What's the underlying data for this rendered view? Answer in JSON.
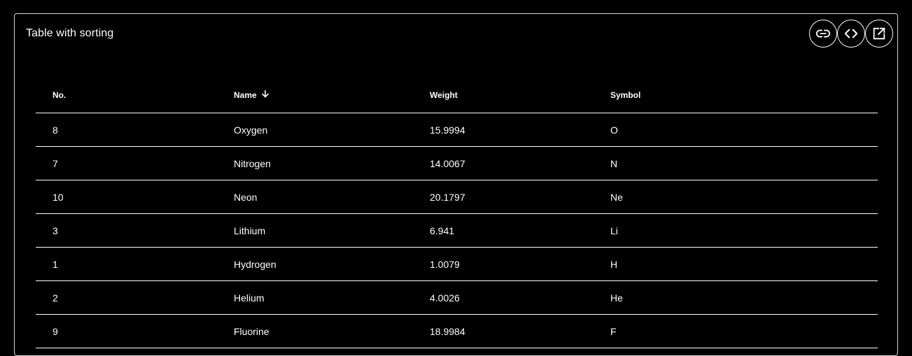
{
  "card": {
    "title": "Table with sorting",
    "actions": [
      {
        "icon": "link-icon",
        "name": "copy-link-button"
      },
      {
        "icon": "code-icon",
        "name": "view-code-button"
      },
      {
        "icon": "open-in-new-icon",
        "name": "open-in-new-button"
      }
    ]
  },
  "table": {
    "columns": {
      "no": "No.",
      "name": "Name",
      "weight": "Weight",
      "symbol": "Symbol"
    },
    "sort": {
      "column": "name",
      "direction": "descending",
      "icon": "arrow-down-icon"
    },
    "rows": [
      {
        "no": "8",
        "name": "Oxygen",
        "weight": "15.9994",
        "symbol": "O"
      },
      {
        "no": "7",
        "name": "Nitrogen",
        "weight": "14.0067",
        "symbol": "N"
      },
      {
        "no": "10",
        "name": "Neon",
        "weight": "20.1797",
        "symbol": "Ne"
      },
      {
        "no": "3",
        "name": "Lithium",
        "weight": "6.941",
        "symbol": "Li"
      },
      {
        "no": "1",
        "name": "Hydrogen",
        "weight": "1.0079",
        "symbol": "H"
      },
      {
        "no": "2",
        "name": "Helium",
        "weight": "4.0026",
        "symbol": "He"
      },
      {
        "no": "9",
        "name": "Fluorine",
        "weight": "18.9984",
        "symbol": "F"
      }
    ]
  },
  "colors": {
    "background": "#000000",
    "text": "#ffffff",
    "border": "#ffffff"
  }
}
